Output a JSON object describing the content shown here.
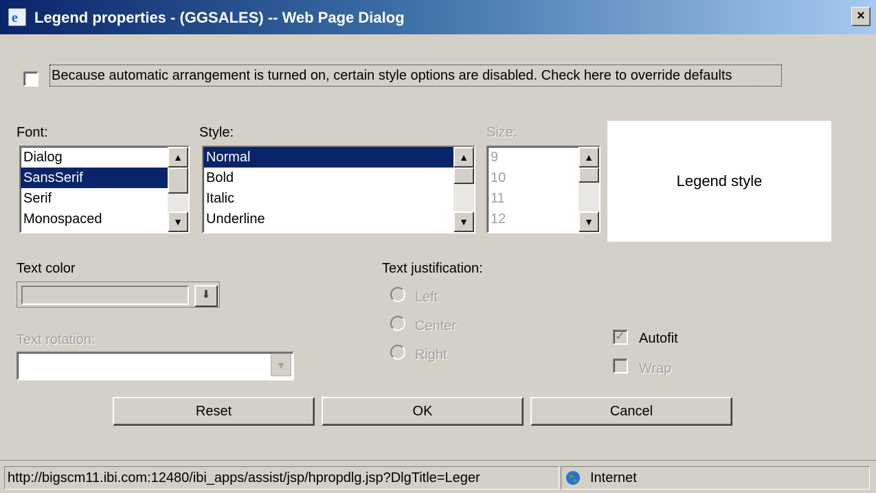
{
  "window": {
    "title": "Legend properties - (GGSALES) -- Web Page Dialog",
    "close_label": "×"
  },
  "override": {
    "label": "Because automatic arrangement is turned on, certain style options are disabled. Check here to override defaults",
    "checked": false
  },
  "font": {
    "label": "Font:",
    "items": [
      "Dialog",
      "SansSerif",
      "Serif",
      "Monospaced"
    ],
    "selected": "SansSerif"
  },
  "style": {
    "label": "Style:",
    "items": [
      "Normal",
      "Bold",
      "Italic",
      "Underline"
    ],
    "selected": "Normal"
  },
  "size": {
    "label": "Size:",
    "items": [
      "9",
      "10",
      "11",
      "12"
    ],
    "disabled": true
  },
  "preview": {
    "text": "Legend style"
  },
  "text_color": {
    "label": "Text color"
  },
  "text_rotation": {
    "label": "Text rotation:",
    "value": ""
  },
  "justification": {
    "label": "Text justification:",
    "options": [
      "Left",
      "Center",
      "Right"
    ]
  },
  "autofit": {
    "label": "Autofit",
    "checked": true
  },
  "wrap": {
    "label": "Wrap",
    "checked": false
  },
  "buttons": {
    "reset": "Reset",
    "ok": "OK",
    "cancel": "Cancel"
  },
  "statusbar": {
    "url": "http://bigscm11.ibi.com:12480/ibi_apps/assist/jsp/hpropdlg.jsp?DlgTitle=Leger",
    "zone": "Internet"
  },
  "icons": {
    "title": "ie-icon",
    "zone": "globe-icon",
    "scroll_up": "arrow-up-icon",
    "scroll_down": "arrow-down-icon",
    "dropdown": "arrow-down-icon"
  }
}
